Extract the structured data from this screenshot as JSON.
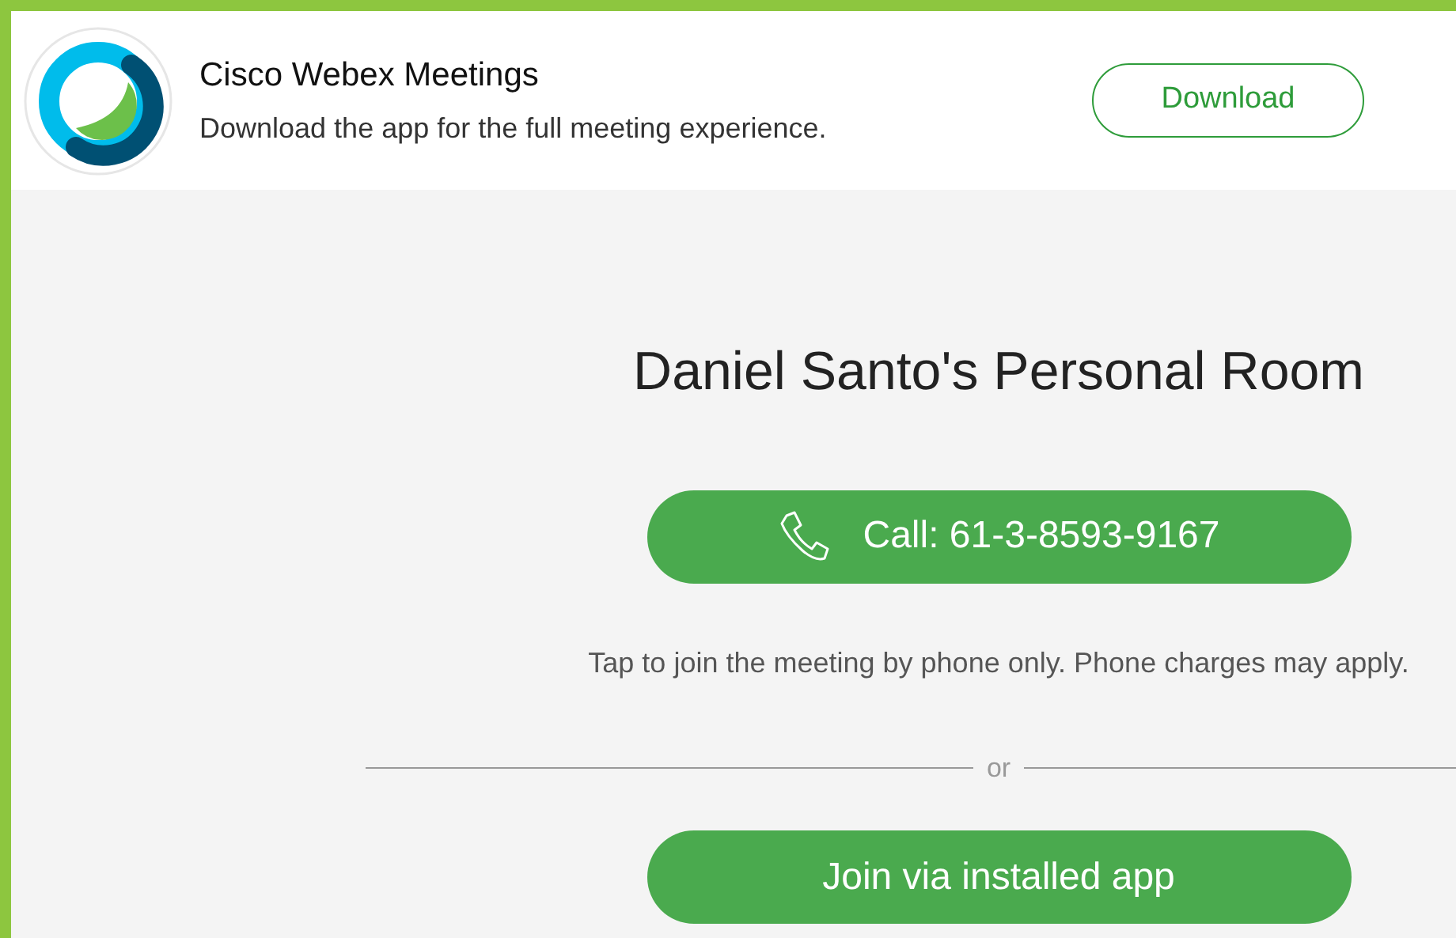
{
  "banner": {
    "app_name": "Cisco Webex Meetings",
    "tagline": "Download the app for the full meeting experience.",
    "download_button": "Download"
  },
  "room_title": "Daniel Santo's Personal Room",
  "call_button": "Call: 61-3-8593-9167",
  "call_note": "Tap to join the meeting by phone only. Phone charges may apply.",
  "divider_label": "or",
  "join_button": "Join via installed app"
}
